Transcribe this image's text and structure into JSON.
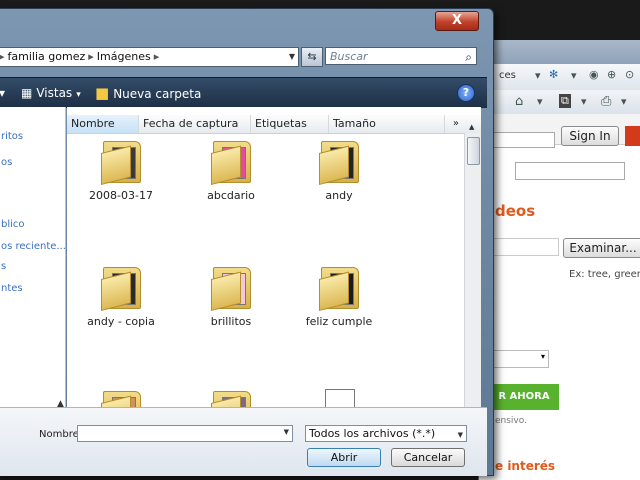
{
  "dialog": {
    "close_label": "X",
    "breadcrumb": [
      "familia gomez",
      "Imágenes"
    ],
    "search_placeholder": "Buscar",
    "toolbar": {
      "views_label": "Vistas",
      "new_folder_label": "Nueva carpeta",
      "help_label": "?"
    },
    "nav_items": [
      "ritos",
      "os",
      "blico",
      "os reciente...",
      "s",
      "ntes"
    ],
    "columns": [
      "Nombre",
      "Fecha de captura",
      "Etiquetas",
      "Tamaño"
    ],
    "columns_more": "»",
    "files": [
      {
        "name": "2008-03-17",
        "paper_color": "#3a3a3a"
      },
      {
        "name": "abcdario",
        "paper_color": "#e64aa0"
      },
      {
        "name": "andy",
        "paper_color": "#222222"
      },
      {
        "name": "andy - copia",
        "paper_color": "#2a2a2a"
      },
      {
        "name": "brillitos",
        "paper_color": "#f2c8dc"
      },
      {
        "name": "feliz cumple",
        "paper_color": "#1a1a1a"
      },
      {
        "name": "",
        "paper_color": "#d09060"
      },
      {
        "name": "",
        "paper_color": "#7a6a8a"
      },
      {
        "name": "",
        "paper_color": "#ffffff"
      }
    ],
    "filename_label": "Nombre",
    "filename_value": "",
    "filetype_value": "Todos los archivos (*.*)",
    "open_label": "Abrir",
    "cancel_label": "Cancelar"
  },
  "browser": {
    "toolbar_text": "ces",
    "signin_label": "Sign In",
    "heading_fragment": "deos",
    "browse_label": "Examinar...",
    "hint_text": "Ex: tree, green",
    "upload_label": "R AHORA",
    "note_text": "ensivo.",
    "bottom_text": "e interés"
  },
  "colors": {
    "accent_orange": "#e05a1c",
    "upload_green": "#59b22e",
    "link_blue": "#3a6fc4"
  }
}
